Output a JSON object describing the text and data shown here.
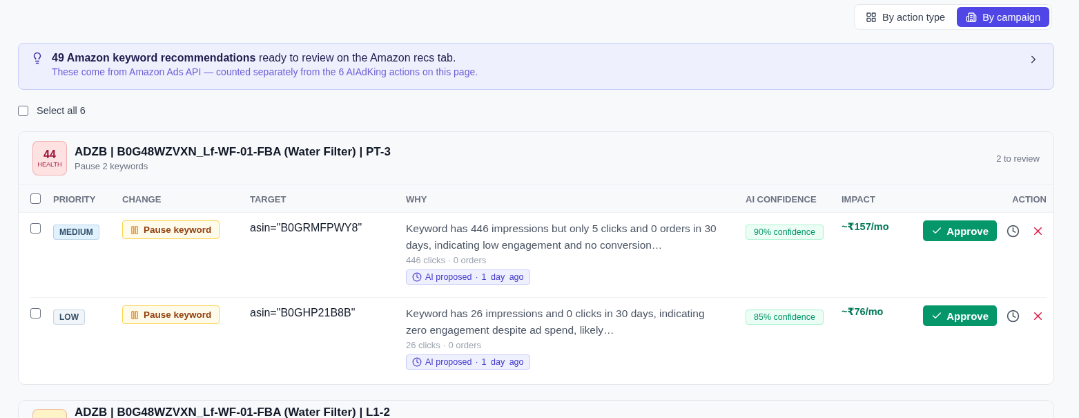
{
  "view_toggle": [
    {
      "label": "By action type",
      "selected": false
    },
    {
      "label": "By campaign",
      "selected": true
    }
  ],
  "banner": {
    "headline": "**49 Amazon keyword recommendations** ready to review on the Amazon recs tab.",
    "note": "These come from Amazon Ads API — counted separately from the 6 AIAdKing actions on this page."
  },
  "select_all": {
    "label": "Select all 6",
    "checked": false
  },
  "campaigns": [
    {
      "health": "44",
      "health_label": "HEALTH",
      "color": "#fee2e2",
      "title": "ADZB | B0G48WZVXN_Lf-WF-01-FBA (Water Filter) | PT-3",
      "subtitle": "Pause 2 keywords",
      "review_count": "2 to review",
      "header_checked": false,
      "columns": [
        "PRIORITY",
        "CHANGE",
        "TARGET",
        "WHY",
        "AI CONFIDENCE",
        "IMPACT",
        "ACTION"
      ],
      "rows": [
        {
          "checked": false,
          "priority": "MEDIUM",
          "color": "#e0f2fe",
          "change": "Pause keyword",
          "target": "asin=\"B0GRMFPWY8\"",
          "why": "Keyword has 446 impressions but only 5 clicks and 0 orders in 30 days, indicating low engagement and no conversion…",
          "stats": "446 clicks · 0 orders",
          "source": "AI proposed",
          "separator": "·",
          "age": "1 day ago",
          "confidence": "90% confidence",
          "impact": "~₹157/mo",
          "approve": "Approve"
        },
        {
          "checked": false,
          "priority": "LOW",
          "color": "#f1f5f9",
          "change": "Pause keyword",
          "target": "asin=\"B0GHP21B8B\"",
          "why": "Keyword has 26 impressions and 0 clicks in 30 days, indicating zero engagement despite ad spend, likely…",
          "stats": "26 clicks · 0 orders",
          "source": "AI proposed",
          "separator": "·",
          "age": "1 day ago",
          "confidence": "85% confidence",
          "impact": "~₹76/mo",
          "approve": "Approve"
        }
      ]
    },
    {
      "color": "#fef3c7",
      "title": "ADZB | B0G48WZVXN_Lf-WF-01-FBA (Water Filter) | L1-2"
    }
  ]
}
